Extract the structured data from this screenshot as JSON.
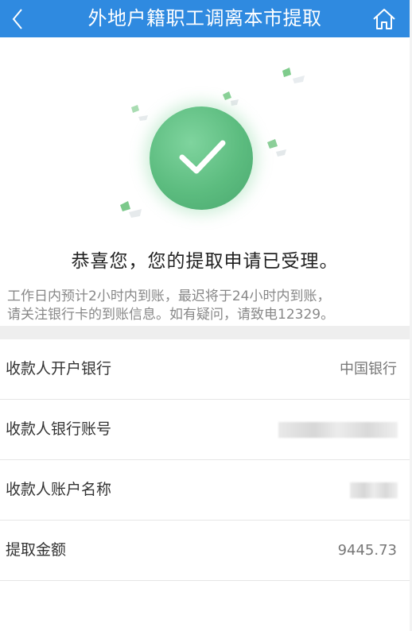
{
  "header": {
    "title": "外地户籍职工调离本市提取",
    "back_icon": "chevron-left-icon",
    "home_icon": "home-icon",
    "background_color": "#2f8ae0"
  },
  "success": {
    "icon": "check-circle-icon",
    "accent_color": "#5cbc7f",
    "title": "恭喜您，您的提取申请已受理。",
    "notice_lines": [
      "工作日内预计2小时内到账，最迟将于24小时内到账，",
      "请关注银行卡的到账信息。如有疑问，请致电12329。"
    ]
  },
  "details": [
    {
      "label": "收款人开户银行",
      "value": "中国银行",
      "masked": false
    },
    {
      "label": "收款人银行账号",
      "value": "",
      "masked": true
    },
    {
      "label": "收款人账户名称",
      "value": "",
      "masked": true
    },
    {
      "label": "提取金额",
      "value": "9445.73",
      "masked": false
    }
  ]
}
